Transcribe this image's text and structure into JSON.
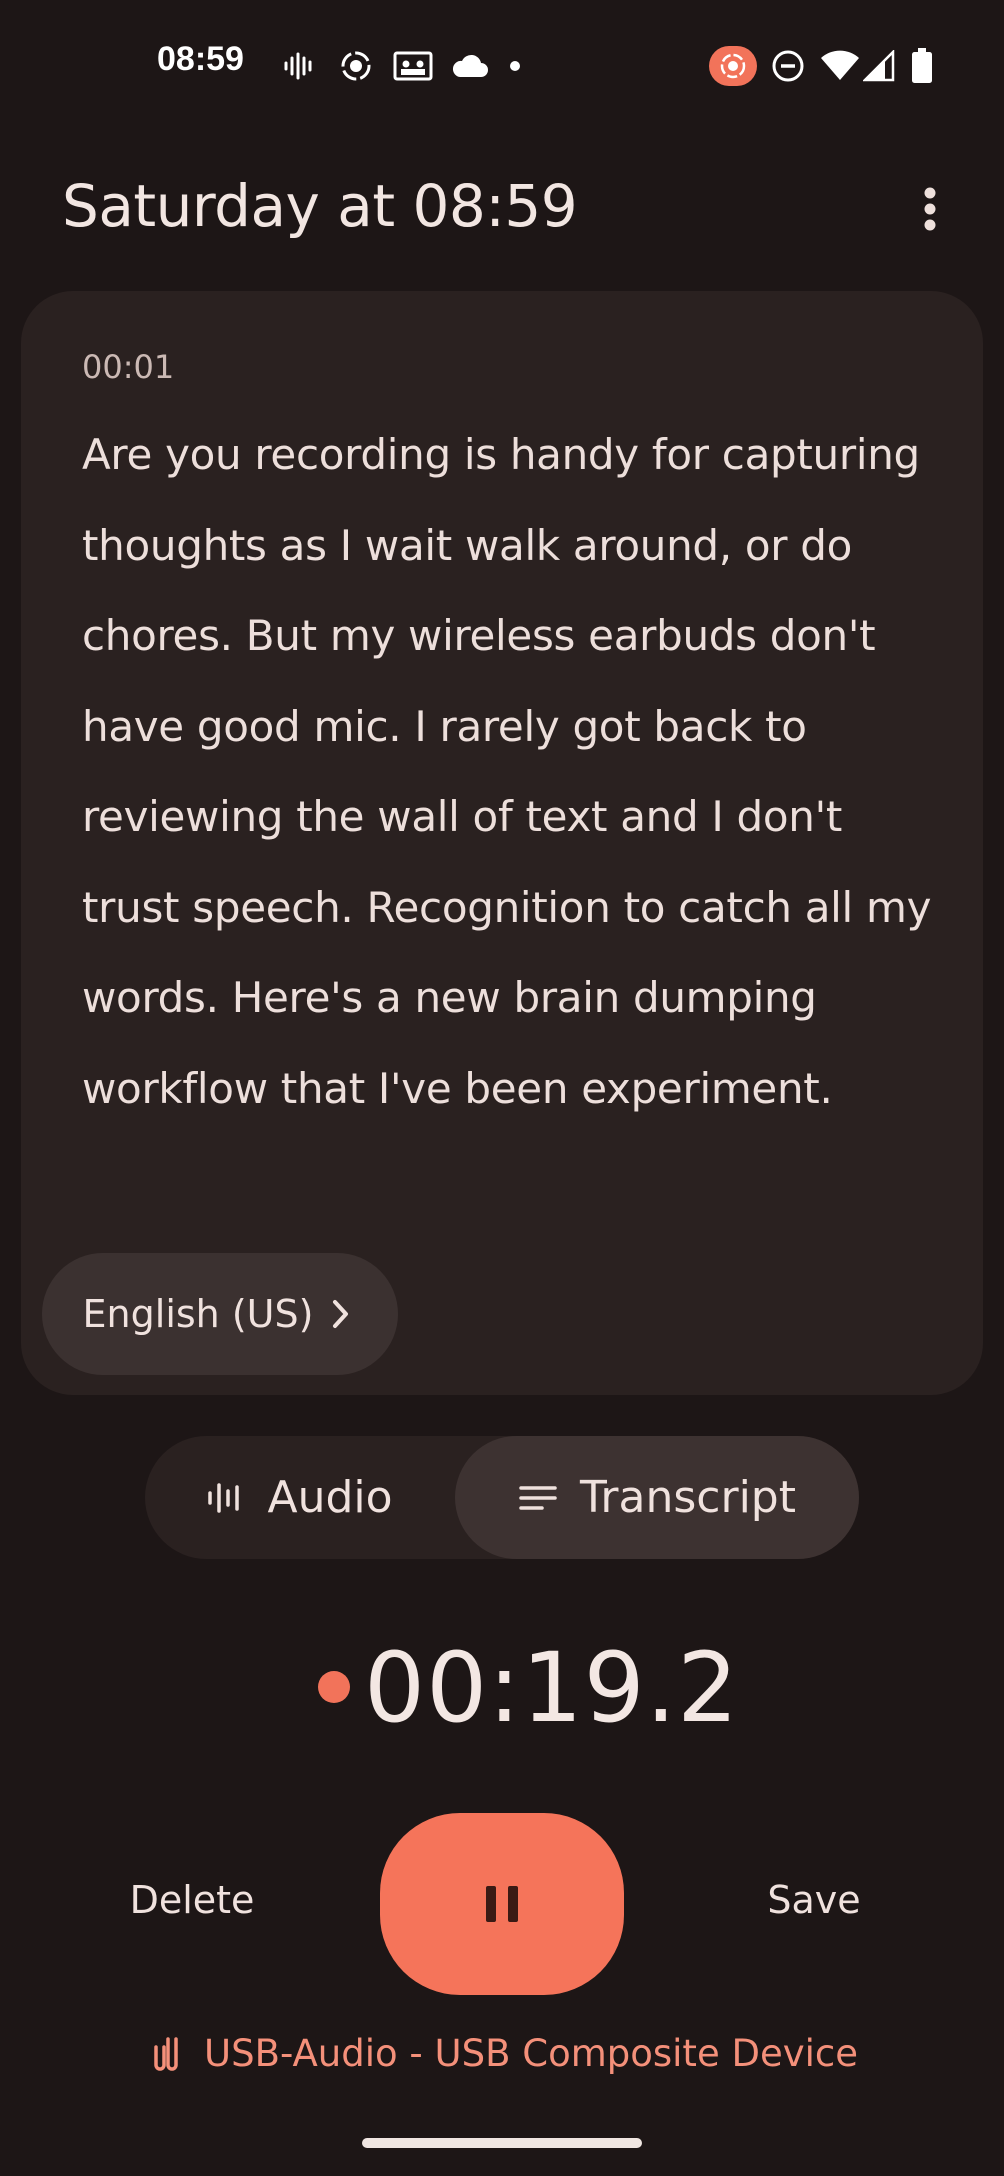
{
  "status_bar": {
    "time": "08:59",
    "left_icons": [
      "voice-waveform-icon",
      "screen-record-icon",
      "photos-icon",
      "cloud-icon",
      "dot-icon"
    ],
    "right_icons": [
      "recording-indicator-icon",
      "do-not-disturb-icon",
      "wifi-icon",
      "cell-signal-icon",
      "battery-icon"
    ],
    "recording_indicator_color": "#f2735a"
  },
  "header": {
    "title": "Saturday at 08:59",
    "menu_icon": "more-vert-icon"
  },
  "transcript_card": {
    "timestamp": "00:01",
    "text": "Are you recording is handy for capturing thoughts as I wait walk around, or do chores. But my wireless earbuds don't have good mic. I rarely got back to reviewing the wall of text and I don't trust speech. Recognition to catch all my words. Here's a new brain dumping workflow that I've been experiment.",
    "language_chip": "English (US)"
  },
  "view_toggle": {
    "audio_label": "Audio",
    "transcript_label": "Transcript",
    "selected": "Transcript"
  },
  "recorder": {
    "elapsed": "00:19.2",
    "delete_label": "Delete",
    "save_label": "Save",
    "pause_icon": "pause-icon",
    "accent_color": "#f5745a"
  },
  "input_device": {
    "label": "USB-Audio - USB Composite Device",
    "icon": "usb-device-icon",
    "color": "#f4907a"
  }
}
